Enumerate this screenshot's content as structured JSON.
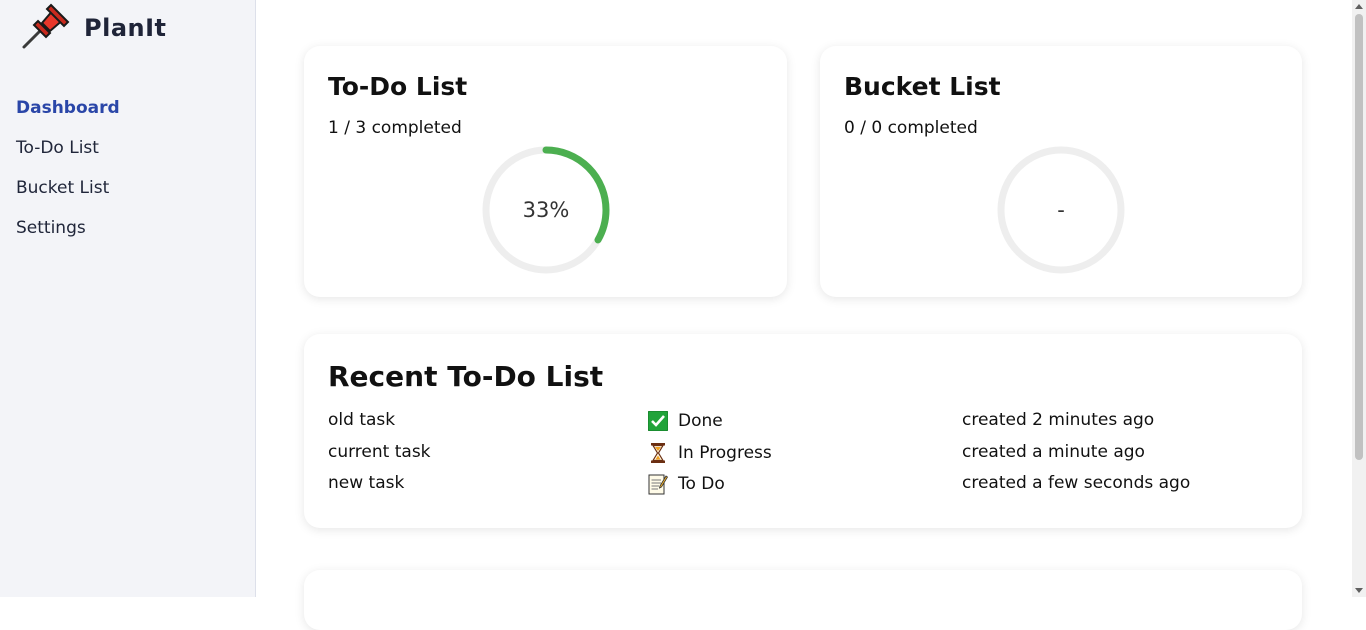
{
  "app": {
    "name": "PlanIt",
    "logo_icon": "pushpin-icon"
  },
  "sidebar": {
    "items": [
      {
        "label": "Dashboard",
        "active": true
      },
      {
        "label": "To-Do List",
        "active": false
      },
      {
        "label": "Bucket List",
        "active": false
      },
      {
        "label": "Settings",
        "active": false
      }
    ]
  },
  "todo_card": {
    "title": "To-Do List",
    "completed_text": "1 / 3 completed",
    "progress_label": "33%",
    "progress_fraction": 0.333
  },
  "bucket_card": {
    "title": "Bucket List",
    "completed_text": "0 / 0 completed",
    "progress_label": "-",
    "progress_fraction": 0
  },
  "recent": {
    "title": "Recent To-Do List",
    "rows": [
      {
        "name": "old task",
        "status": "Done",
        "status_icon": "checkmark-icon",
        "created": "created 2 minutes ago"
      },
      {
        "name": "current task",
        "status": "In Progress",
        "status_icon": "hourglass-icon",
        "created": "created a minute ago"
      },
      {
        "name": "new task",
        "status": "To Do",
        "status_icon": "memo-icon",
        "created": "created a few seconds ago"
      }
    ]
  },
  "colors": {
    "accent": "#2a46a8",
    "progress": "#4caf50",
    "ring_track": "#eeeeee",
    "sidebar_bg": "#f3f4f8"
  }
}
